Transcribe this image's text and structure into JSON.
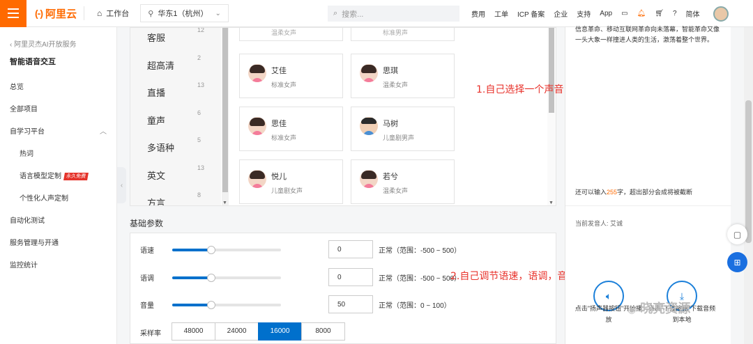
{
  "topbar": {
    "logo": "阿里云",
    "logo_mark": "(-)",
    "workbench": "工作台",
    "region": "华东1（杭州）",
    "search_placeholder": "搜索...",
    "nav": [
      "费用",
      "工单",
      "ICP 备案",
      "企业",
      "支持",
      "App"
    ],
    "language": "简体"
  },
  "sidebar": {
    "back": "阿里灵杰AI开放服务",
    "title": "智能语音交互",
    "items": [
      {
        "label": "总览"
      },
      {
        "label": "全部项目"
      },
      {
        "label": "自学习平台"
      },
      {
        "label": "热词"
      },
      {
        "label": "语言模型定制",
        "badge": "永久免费"
      },
      {
        "label": "个性化人声定制"
      },
      {
        "label": "自动化测试"
      },
      {
        "label": "服务管理与开通"
      },
      {
        "label": "监控统计"
      }
    ]
  },
  "categories": [
    {
      "name": "客服",
      "count": "12"
    },
    {
      "name": "超高清",
      "count": "2"
    },
    {
      "name": "直播",
      "count": "13"
    },
    {
      "name": "童声",
      "count": "6"
    },
    {
      "name": "多语种",
      "count": "5"
    },
    {
      "name": "英文",
      "count": "13"
    },
    {
      "name": "方言",
      "count": "8"
    }
  ],
  "voices_top": [
    "温柔女声",
    "标准男声"
  ],
  "voices": [
    {
      "name": "艾佳",
      "desc": "标准女声",
      "gender": "female"
    },
    {
      "name": "思琪",
      "desc": "温柔女声",
      "gender": "female"
    },
    {
      "name": "思佳",
      "desc": "标准女声",
      "gender": "female"
    },
    {
      "name": "马树",
      "desc": "儿童剧男声",
      "gender": "male"
    },
    {
      "name": "悦儿",
      "desc": "儿童剧女声",
      "gender": "female"
    },
    {
      "name": "若兮",
      "desc": "温柔女声",
      "gender": "female"
    }
  ],
  "annotations": {
    "a1": "1.自己选择一个声音",
    "a2": "2.自己调节语速，语调，音量"
  },
  "params": {
    "title": "基础参数",
    "rows": [
      {
        "label": "语速",
        "value": "0",
        "hint": "正常（范围：-500 ~ 500）",
        "level": 0.5
      },
      {
        "label": "语调",
        "value": "0",
        "hint": "正常（范围：-500 ~ 500）",
        "level": 0.5
      },
      {
        "label": "音量",
        "value": "50",
        "hint": "正常（范围：0 ~ 100）",
        "level": 0.5
      }
    ],
    "rate_label": "采样率",
    "rates": [
      "48000",
      "24000",
      "16000",
      "8000"
    ],
    "rate_selected": "16000"
  },
  "right": {
    "text": "信息革命、移动互联网革命向未落幕，智能革命又像一头大象一样撞进人类的生活，激荡着整个世界。",
    "count_prefix": "还可以输入",
    "count_num": "255",
    "count_suffix": "字，超出部分会成将被截断",
    "current_speaker": "当前发音人: 艾诚",
    "play_caption": "点击\"扬声器按钮\"开始播放",
    "download_caption": "点击\"下载按钮\"下载音频到本地"
  },
  "watermark": "晓亮资源",
  "colors": {
    "brand": "#ff6a00",
    "primary": "#0070cc",
    "annotation": "#e8322b"
  }
}
